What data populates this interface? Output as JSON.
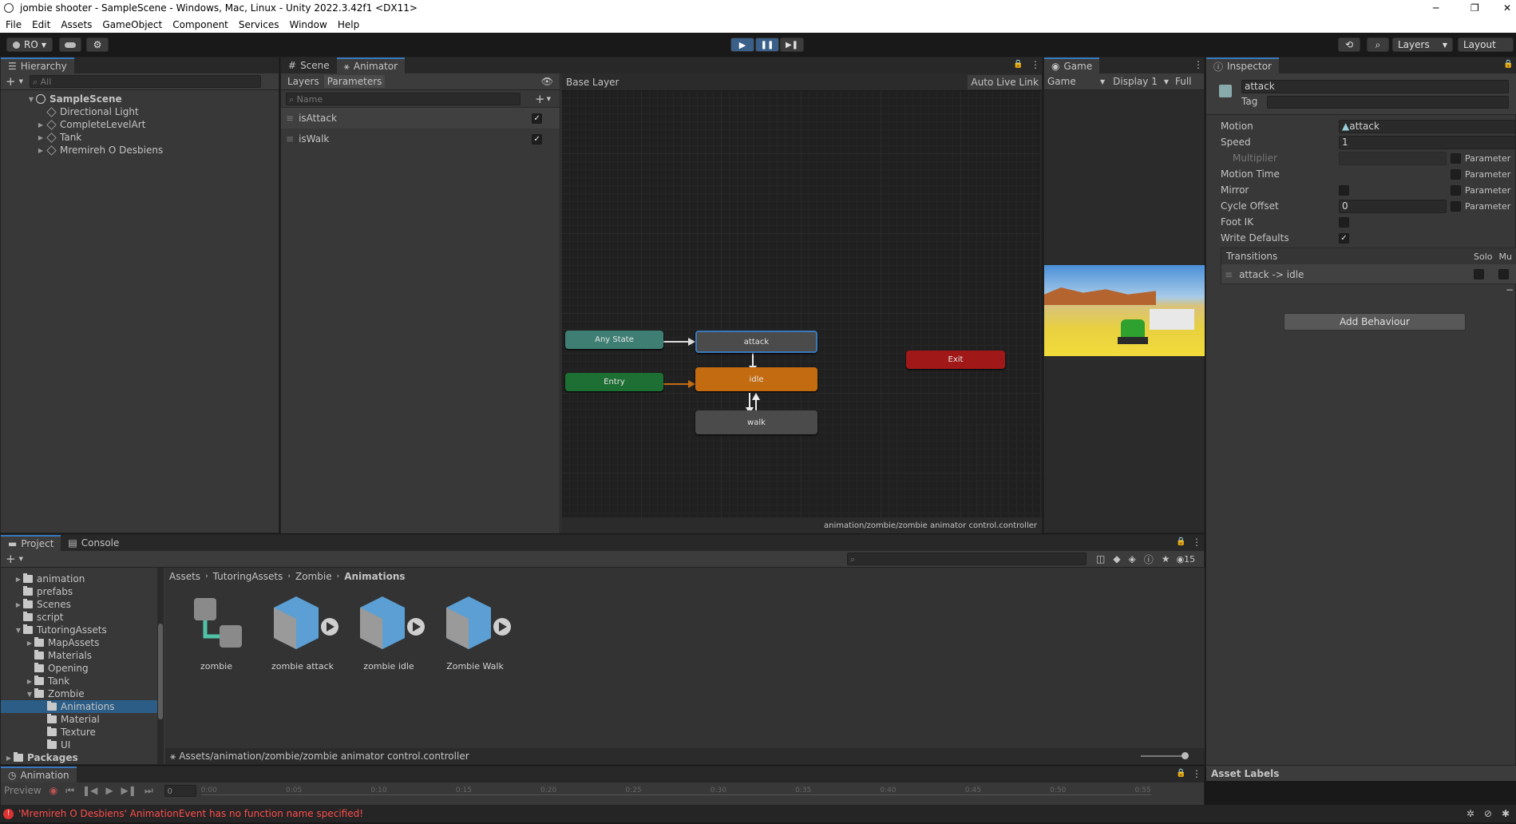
{
  "window": {
    "title": "jombie shooter - SampleScene - Windows, Mac, Linux - Unity 2022.3.42f1 <DX11>",
    "minimize": "─",
    "maximize": "❐",
    "close": "✕"
  },
  "menu": [
    "File",
    "Edit",
    "Assets",
    "GameObject",
    "Component",
    "Services",
    "Window",
    "Help"
  ],
  "toolbar": {
    "account": "RO",
    "layers": "Layers",
    "layout": "Layout"
  },
  "hierarchy": {
    "tab": "Hierarchy",
    "search_placeholder": "All",
    "scene": "SampleScene",
    "items": [
      "Directional Light",
      "CompleteLevelArt",
      "Tank",
      "Mremireh O Desbiens"
    ]
  },
  "scene_tabs": {
    "scene": "Scene",
    "animator": "Animator"
  },
  "animator": {
    "layers_tab": "Layers",
    "parameters_tab": "Parameters",
    "search_placeholder": "Name",
    "params": [
      {
        "name": "isAttack",
        "checked": true
      },
      {
        "name": "isWalk",
        "checked": true
      }
    ],
    "breadcrumb": "Base Layer",
    "auto_live_link": "Auto Live Link",
    "footer": "animation/zombie/zombie animator control.controller",
    "nodes": {
      "any_state": "Any State",
      "entry": "Entry",
      "attack": "attack",
      "idle": "idle",
      "walk": "walk",
      "exit": "Exit"
    }
  },
  "game": {
    "tab": "Game",
    "dropdown": "Game",
    "display": "Display 1",
    "full": "Full"
  },
  "inspector": {
    "tab": "Inspector",
    "name": "attack",
    "tag_label": "Tag",
    "motion_label": "Motion",
    "motion_value": "attack",
    "speed_label": "Speed",
    "speed_value": "1",
    "multiplier_label": "Multiplier",
    "motion_time_label": "Motion Time",
    "mirror_label": "Mirror",
    "cycle_offset_label": "Cycle Offset",
    "cycle_offset_value": "0",
    "foot_ik_label": "Foot IK",
    "write_defaults_label": "Write Defaults",
    "parameter": "Parameter",
    "transitions_label": "Transitions",
    "solo": "Solo",
    "mute": "Mu",
    "transition": "attack -> idle",
    "minus": "−",
    "add_behaviour": "Add Behaviour",
    "asset_labels": "Asset Labels"
  },
  "project": {
    "tab": "Project",
    "console_tab": "Console",
    "hidden_count": "15",
    "breadcrumb": [
      "Assets",
      "TutoringAssets",
      "Zombie",
      "Animations"
    ],
    "tree": [
      {
        "label": "animation",
        "indent": 0,
        "arrow": "▶"
      },
      {
        "label": "prefabs",
        "indent": 0,
        "arrow": ""
      },
      {
        "label": "Scenes",
        "indent": 0,
        "arrow": "▶"
      },
      {
        "label": "script",
        "indent": 0,
        "arrow": ""
      },
      {
        "label": "TutoringAssets",
        "indent": 0,
        "arrow": "▼"
      },
      {
        "label": "MapAssets",
        "indent": 1,
        "arrow": "▶"
      },
      {
        "label": "Materials",
        "indent": 1,
        "arrow": ""
      },
      {
        "label": "Opening",
        "indent": 1,
        "arrow": ""
      },
      {
        "label": "Tank",
        "indent": 1,
        "arrow": "▶"
      },
      {
        "label": "Zombie",
        "indent": 1,
        "arrow": "▼"
      },
      {
        "label": "Animations",
        "indent": 2,
        "arrow": ""
      },
      {
        "label": "Material",
        "indent": 2,
        "arrow": ""
      },
      {
        "label": "Texture",
        "indent": 2,
        "arrow": ""
      },
      {
        "label": "UI",
        "indent": 2,
        "arrow": ""
      },
      {
        "label": "Packages",
        "indent": -1,
        "arrow": "▶"
      }
    ],
    "assets": [
      "zombie",
      "zombie attack",
      "zombie idle",
      "Zombie Walk"
    ],
    "path": "Assets/animation/zombie/zombie animator control.controller"
  },
  "animation": {
    "tab": "Animation",
    "preview": "Preview",
    "frame": "0",
    "ticks": [
      "0:00",
      "0:05",
      "0:10",
      "0:15",
      "0:20",
      "0:25",
      "0:30",
      "0:35",
      "0:40",
      "0:45",
      "0:50",
      "0:55"
    ]
  },
  "status": {
    "message": "'Mremireh O Desbiens' AnimationEvent has no function name specified!"
  },
  "colors": {
    "accent": "#3a79bb",
    "any_state": "#3f7f73",
    "entry": "#1e6f34",
    "idle": "#c36b10",
    "exit": "#a11818",
    "error": "#ff4d4d"
  }
}
